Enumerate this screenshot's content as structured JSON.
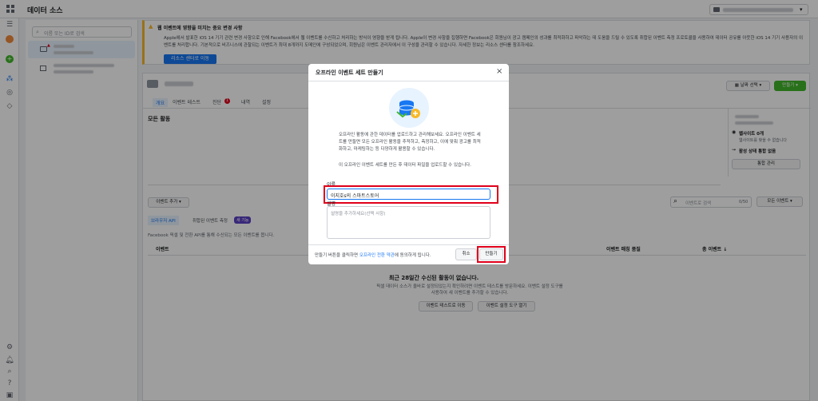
{
  "header": {
    "title": "데이터 소스"
  },
  "source_panel": {
    "search_placeholder": "이름 또는 ID로 검색"
  },
  "banner": {
    "title": "웹 이벤트에 영향을 미치는 중요 변경 사항",
    "body": "Apple에서 발표한 iOS 14 기기 관련 변경 사항으로 인해 Facebook에서 웹 이벤트를 수신하고 처리하는 방식이 영향을 받게 됩니다. Apple이 변경 사항을 집행하면 Facebook은 회원님이 광고 캠페인의 성과를 최적화하고 파악하는 데 도움을 드릴 수 있도록 취합된 이벤트 측정 프로토콜을 사용하여 데이터 공유를 아웃한 iOS 14 기기 사용자의 이벤트를 처리합니다. 기본적으로 비즈니스에 관찰되는 이벤트가 최대 8개까지 도메인에 구성되었으며, 회원님은 이벤트 관리자에서 이 구성을 관리할 수 있습니다. 자세한 정보는 리소스 센터를 참조하세요.",
    "button": "리소스 센터로 이동"
  },
  "card": {
    "tabs": [
      "개요",
      "이벤트 테스트",
      "진단",
      "내역",
      "설정"
    ],
    "diag_badge": "1",
    "date_button": "날짜 선택",
    "create_button": "만들기",
    "all_activity": "모든 활동",
    "add_event": "이벤트 추가",
    "subtab_browser": "브라우저 API",
    "subtab_aggregated": "취합된 이벤트 측정",
    "new_badge": "새 기능",
    "subtab_desc": "Facebook 픽셀 및 전환 API를 통해 수신되는 모든 이벤트를 봅니다.",
    "col_event": "이벤트",
    "col_matching": "이벤트 매칭 품질",
    "col_total": "총 이벤트 ↓",
    "search_placeholder": "이벤트로 검색",
    "search_count": "0/50",
    "filter": "모든 이벤트",
    "empty_title": "최근 28일간 수신된 활동이 없습니다.",
    "empty_body": "픽셀 데이터 소스가 올바로 설정되었는지 확인하려면 이벤트 테스트를 방문하세요. 이벤트 설정 도구를 사용하여 새 이벤트를 추가할 수 있습니다.",
    "test_button": "이벤트 테스트로 이동",
    "setup_button": "이벤트 설정 도구 열기",
    "right_websites": "웹사이트 0개",
    "right_websites_sub": "웹사이트를 찾을 수 없습니다",
    "right_status": "활성 상태 통합 없음",
    "right_manage": "통합 관리"
  },
  "modal": {
    "title": "오프라인 이벤트 세트 만들기",
    "description": "오프라인 활동에 관한 데이터를 업로드하고 관리해보세요. 오프라인 이벤트 세트를 만들면 모든 오프라인 활동을 추적하고, 측정하고, 이에 맞춰 광고를 최적화하고, 마케팅하는 등 다양하게 활용할 수 있습니다.",
    "description2": "이 오프라인 이벤트 세트를 만든 후 데이터 파일을 업로드할 수 있습니다.",
    "name_label": "이름",
    "name_value": "이지호s의 스마트스토어",
    "desc_label": "설명",
    "desc_placeholder": "설명을 추가하세요(선택 사항)",
    "terms_prefix": "만들기 버튼을 클릭하면 ",
    "terms_link": "오프라인 전환 약관",
    "terms_suffix": "에 동의하게 됩니다.",
    "cancel": "취소",
    "create": "만들기"
  },
  "colors": {
    "accent": "#1877f2",
    "highlight": "#e0001b",
    "create_green": "#42b72a"
  }
}
